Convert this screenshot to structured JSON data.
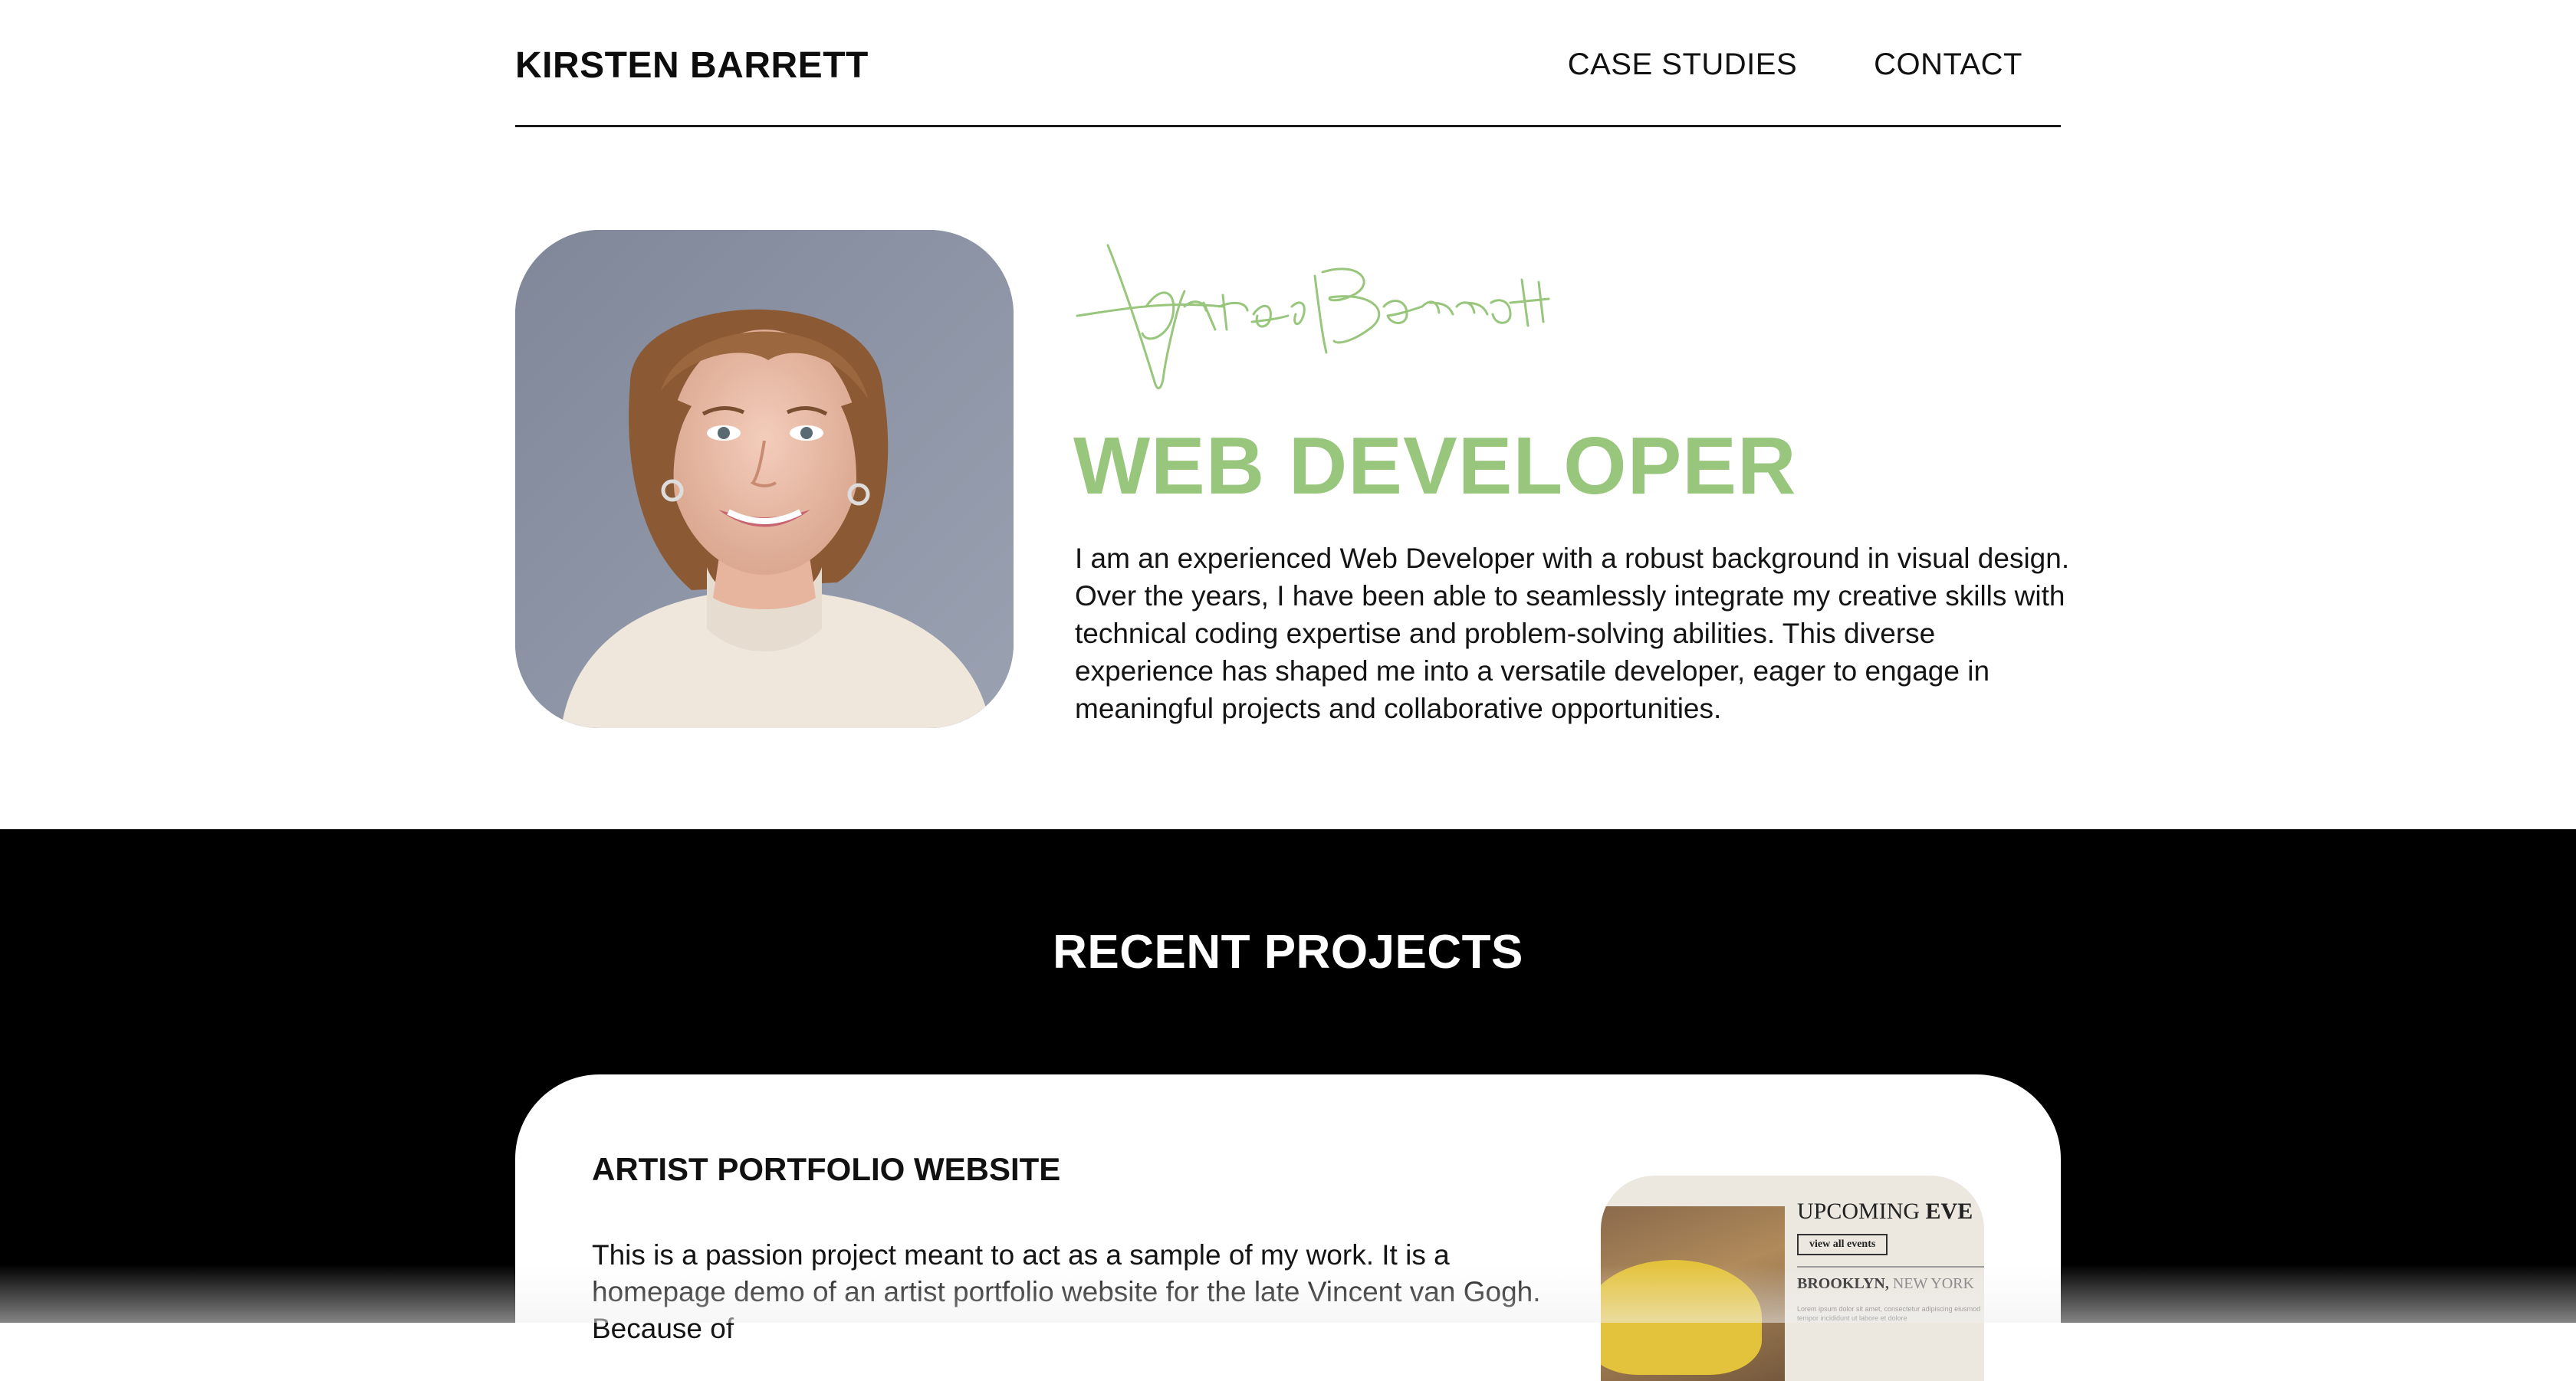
{
  "header": {
    "brand": "KIRSTEN BARRETT",
    "nav": [
      "CASE STUDIES",
      "CONTACT"
    ]
  },
  "hero": {
    "photo_alt": "Portrait of Kirsten Barrett",
    "signature_text": "Kirsten Barrett",
    "role": "WEB DEVELOPER",
    "bio": "I am an experienced Web Developer with a robust background in visual design. Over the years, I have been able to seamlessly integrate my creative skills with technical coding expertise and problem-solving abilities. This diverse experience has shaped me into a versatile developer, eager to engage in meaningful projects and collaborative opportunities."
  },
  "projects_section": {
    "title": "RECENT PROJECTS",
    "projects": [
      {
        "title": "ARTIST PORTFOLIO WEBSITE",
        "description": "This is a passion project meant to act as a sample of my work. It is a homepage demo of an artist portfolio website for the late Vincent van Gogh. Because of",
        "preview": {
          "upcoming_label": "UPCOMING",
          "upcoming_bold": "EVE",
          "button": "view all events",
          "city_bold": "BROOKLYN,",
          "city_rest": "NEW YORK",
          "lorem": "Lorem ipsum dolor sit amet, consectetur adipiscing eiusmod tempor incididunt ut labore et dolore"
        }
      }
    ]
  },
  "colors": {
    "accent_green": "#98c67c",
    "dark_bg": "#000000",
    "text": "#111111"
  }
}
